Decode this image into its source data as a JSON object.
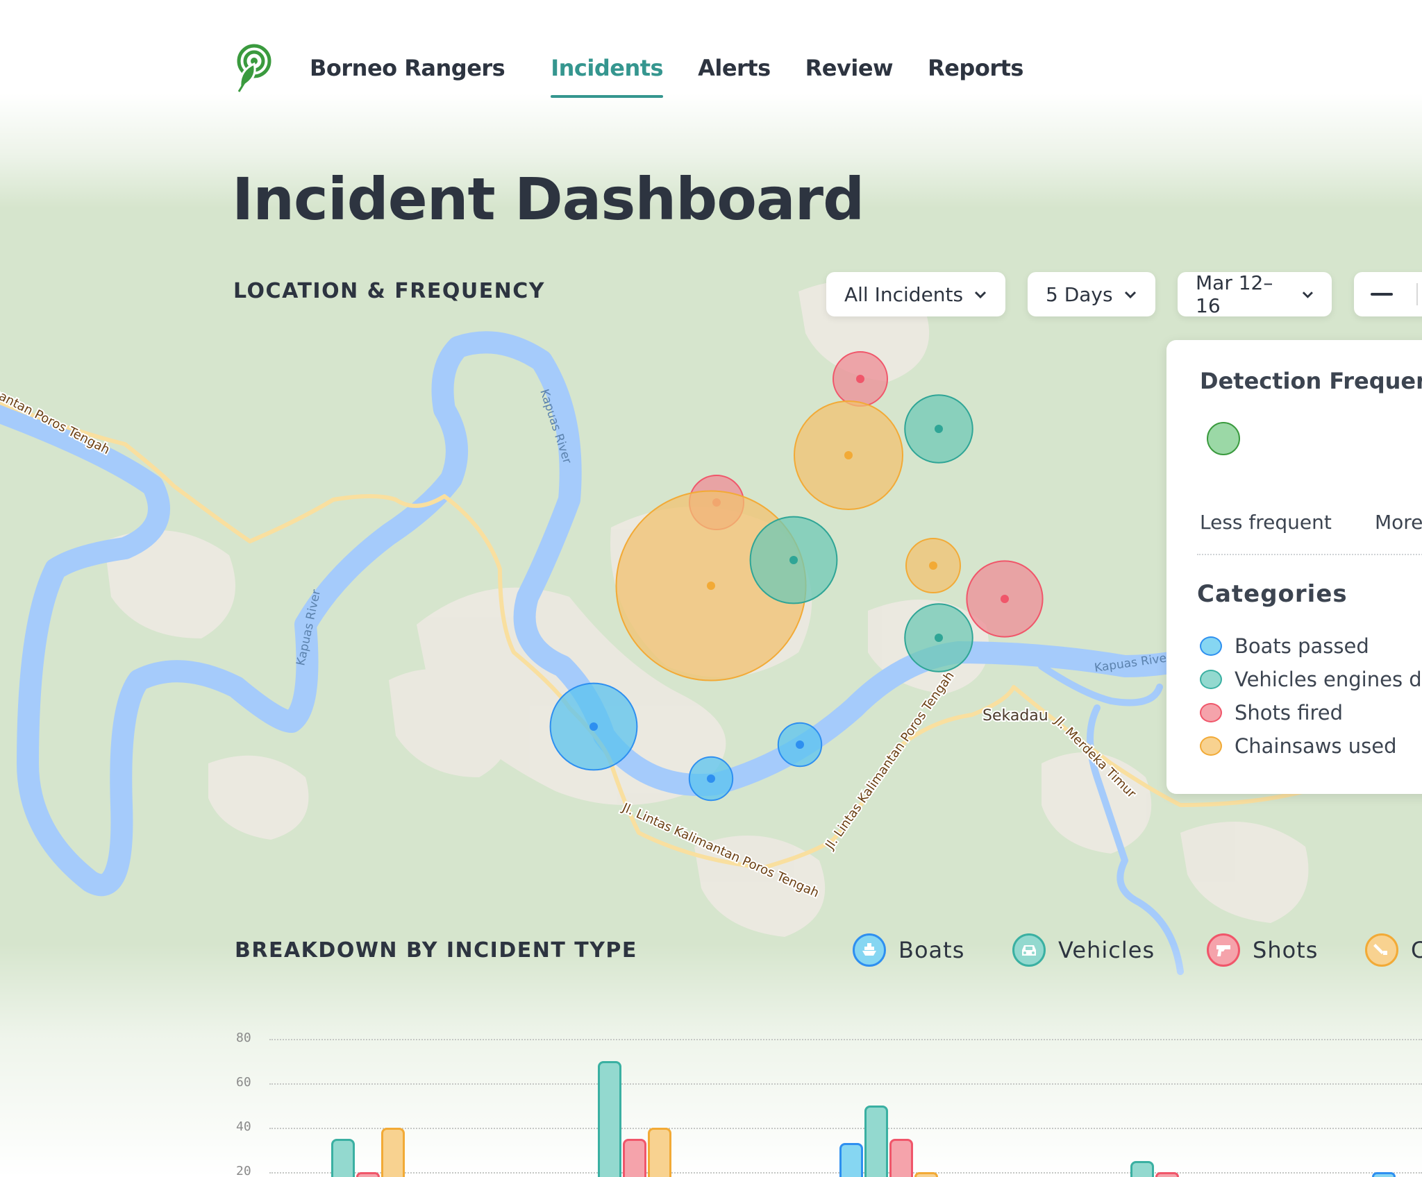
{
  "nav": {
    "brand": "Borneo Rangers",
    "links": [
      {
        "label": "Incidents",
        "active": true
      },
      {
        "label": "Alerts",
        "active": false
      },
      {
        "label": "Review",
        "active": false
      },
      {
        "label": "Reports",
        "active": false
      }
    ]
  },
  "page_title": "Incident Dashboard",
  "location_section": {
    "heading": "LOCATION & FREQUENCY",
    "filters": {
      "type": "All Incidents",
      "range": "5 Days",
      "dates": "Mar 12–16"
    },
    "zoom_out_icon": "minus-icon"
  },
  "map": {
    "labels": {
      "river1": "Kapuas River",
      "river2": "Kapuas River",
      "river3": "Kapuas River",
      "road_nw": "Jl. Lintas Kalimantan Poros Tengah",
      "road_s1": "Jl. Lintas Kalimantan Poros Tengah",
      "road_s2": "Jl. Lintas Kalimantan Poros Tengah",
      "town": "Sekadau",
      "road_e": "Jl. Merdeka Timur"
    },
    "markers": [
      {
        "category": "shots",
        "frequency": 2
      },
      {
        "category": "chainsaws",
        "frequency": 4
      },
      {
        "category": "vehicles",
        "frequency": 2.5
      },
      {
        "category": "shots",
        "frequency": 2
      },
      {
        "category": "chainsaws",
        "frequency": 7
      },
      {
        "category": "vehicles",
        "frequency": 3.2
      },
      {
        "category": "chainsaws",
        "frequency": 2
      },
      {
        "category": "shots",
        "frequency": 2.8
      },
      {
        "category": "vehicles",
        "frequency": 2.5
      },
      {
        "category": "boats",
        "frequency": 3.2
      },
      {
        "category": "boats",
        "frequency": 1.6
      },
      {
        "category": "boats",
        "frequency": 1.6
      }
    ]
  },
  "legend": {
    "title": "Detection Frequency",
    "less": "Less frequent",
    "more": "More frequent",
    "categories_title": "Categories",
    "categories": [
      {
        "label": "Boats passed",
        "fill": "#86d6f2",
        "stroke": "#2e8ff0"
      },
      {
        "label": "Vehicles engines detected",
        "fill": "#93d9cf",
        "stroke": "#3ab0a2"
      },
      {
        "label": "Shots fired",
        "fill": "#f5a3ab",
        "stroke": "#f0566a"
      },
      {
        "label": "Chainsaws used",
        "fill": "#f8d290",
        "stroke": "#f2aa36"
      }
    ]
  },
  "breakdown_section": {
    "heading": "BREAKDOWN BY INCIDENT TYPE",
    "types": [
      {
        "label": "Boats",
        "icon": "boat-icon"
      },
      {
        "label": "Vehicles",
        "icon": "car-icon"
      },
      {
        "label": "Shots",
        "icon": "gun-icon"
      },
      {
        "label": "Chainsaws",
        "icon": "chainsaw-icon"
      }
    ]
  },
  "chart_data": {
    "type": "bar",
    "title": "Breakdown by Incident Type",
    "ylim": [
      0,
      80
    ],
    "yticks": [
      "80",
      "60",
      "40",
      "20"
    ],
    "grid": true,
    "series": [
      {
        "name": "Boats",
        "values": [
          null,
          null,
          33,
          null,
          20
        ]
      },
      {
        "name": "Vehicles",
        "values": [
          35,
          70,
          50,
          25,
          null
        ]
      },
      {
        "name": "Shots",
        "values": [
          20,
          35,
          35,
          20,
          null
        ]
      },
      {
        "name": "Chainsaws",
        "values": [
          40,
          40,
          20,
          null,
          null
        ]
      }
    ]
  }
}
